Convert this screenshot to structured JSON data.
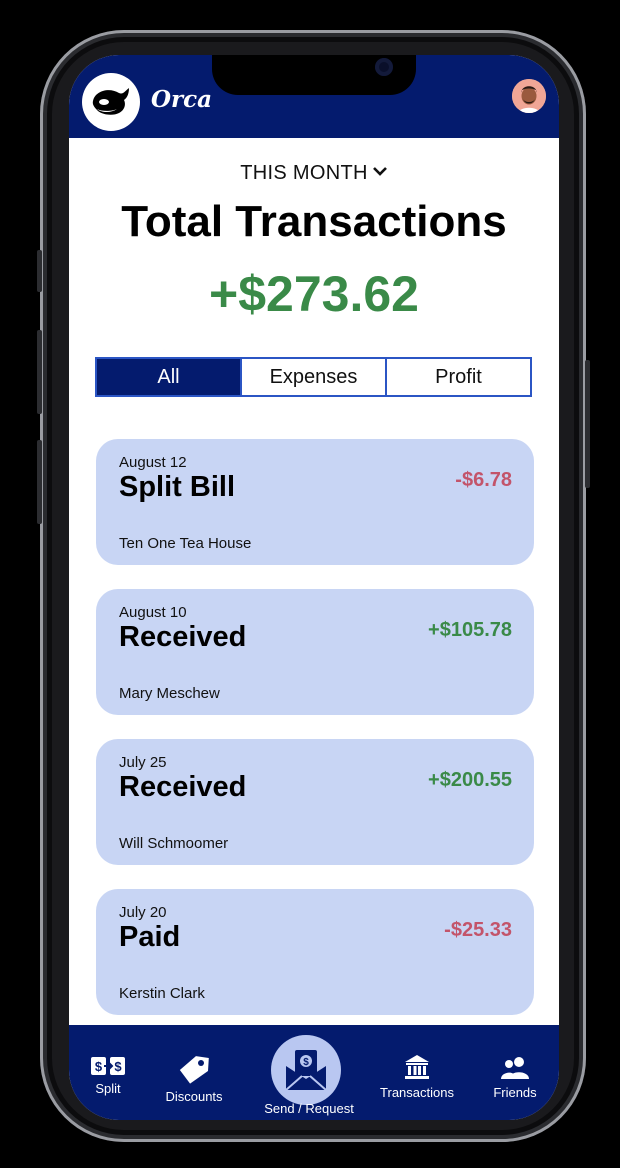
{
  "app": {
    "name": "Orca"
  },
  "summary": {
    "period": "THIS MONTH",
    "title": "Total Transactions",
    "total": "+$273.62"
  },
  "filters": [
    "All",
    "Expenses",
    "Profit"
  ],
  "active_filter": "All",
  "transactions": [
    {
      "date": "August 12",
      "type": "Split Bill",
      "party": "Ten One Tea House",
      "amount": "-$6.78"
    },
    {
      "date": "August 10",
      "type": "Received",
      "party": "Mary Meschew",
      "amount": "+$105.78"
    },
    {
      "date": "July 25",
      "type": "Received",
      "party": "Will Schmoomer",
      "amount": "+$200.55"
    },
    {
      "date": "July 20",
      "type": "Paid",
      "party": "Kerstin Clark",
      "amount": "-$25.33"
    }
  ],
  "nav": {
    "split": "Split",
    "discounts": "Discounts",
    "send_request": "Send / Request",
    "transactions": "Transactions",
    "friends": "Friends"
  },
  "colors": {
    "brand_navy": "#041b6e",
    "card_bg": "#c8d5f4",
    "positive": "#3a8a48",
    "negative": "#c3546a"
  },
  "icons": [
    "orca-logo-icon",
    "chevron-down-icon",
    "split-icon",
    "tag-icon",
    "envelope-money-icon",
    "bank-icon",
    "friends-icon"
  ]
}
